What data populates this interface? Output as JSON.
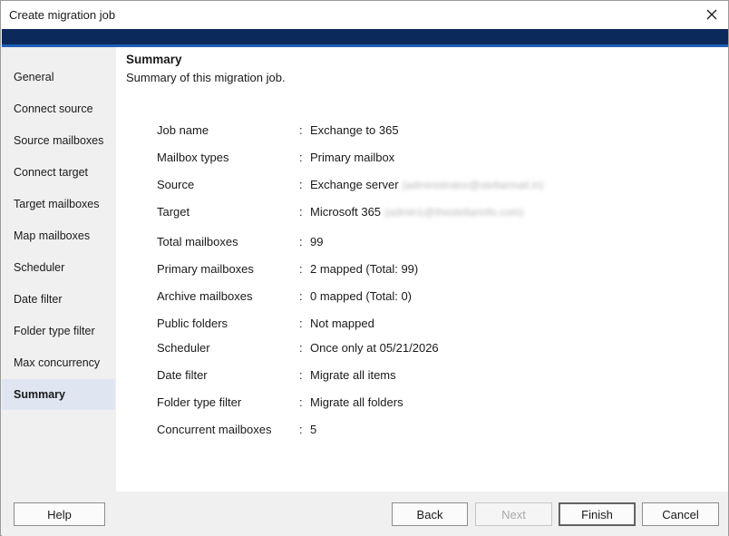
{
  "window": {
    "title": "Create migration job"
  },
  "sidebar": {
    "items": [
      {
        "label": "General",
        "active": false
      },
      {
        "label": "Connect source",
        "active": false
      },
      {
        "label": "Source mailboxes",
        "active": false
      },
      {
        "label": "Connect target",
        "active": false
      },
      {
        "label": "Target mailboxes",
        "active": false
      },
      {
        "label": "Map mailboxes",
        "active": false
      },
      {
        "label": "Scheduler",
        "active": false
      },
      {
        "label": "Date filter",
        "active": false
      },
      {
        "label": "Folder type filter",
        "active": false
      },
      {
        "label": "Max concurrency",
        "active": false
      },
      {
        "label": "Summary",
        "active": true
      }
    ]
  },
  "main": {
    "heading": "Summary",
    "subheading": "Summary of this migration job.",
    "rows": [
      {
        "label": "Job name",
        "colon": ":",
        "value": "Exchange to 365"
      },
      {
        "label": "Mailbox types",
        "colon": ":",
        "value": "Primary mailbox"
      },
      {
        "label": "Source",
        "colon": ":",
        "value": "Exchange server",
        "blurred": "(administrator@stellarmail.in)"
      },
      {
        "label": "Target",
        "colon": ":",
        "value": "Microsoft 365",
        "blurred": "(admin1@thestellarinfo.com)"
      },
      {
        "label": "Total mailboxes",
        "colon": ":",
        "value": "99"
      },
      {
        "label": "Primary mailboxes",
        "colon": ":",
        "value": "2 mapped (Total: 99)"
      },
      {
        "label": "Archive mailboxes",
        "colon": ":",
        "value": "0 mapped (Total: 0)"
      },
      {
        "label": "Public folders",
        "colon": ":",
        "value": "Not mapped"
      },
      {
        "label": "Scheduler",
        "colon": ":",
        "value": "Once only at 05/21/2026"
      },
      {
        "label": "Date filter",
        "colon": ":",
        "value": "Migrate all items"
      },
      {
        "label": "Folder type filter",
        "colon": ":",
        "value": "Migrate all folders"
      },
      {
        "label": "Concurrent mailboxes",
        "colon": ":",
        "value": "5"
      }
    ]
  },
  "footer": {
    "help_label": "Help",
    "back_label": "Back",
    "next_label": "Next",
    "finish_label": "Finish",
    "cancel_label": "Cancel"
  },
  "colors": {
    "banner": "#0b2a5b",
    "banner_accent": "#1f5fb8",
    "active_nav": "#dfe6f1"
  },
  "icons": {
    "close": "close-icon"
  }
}
